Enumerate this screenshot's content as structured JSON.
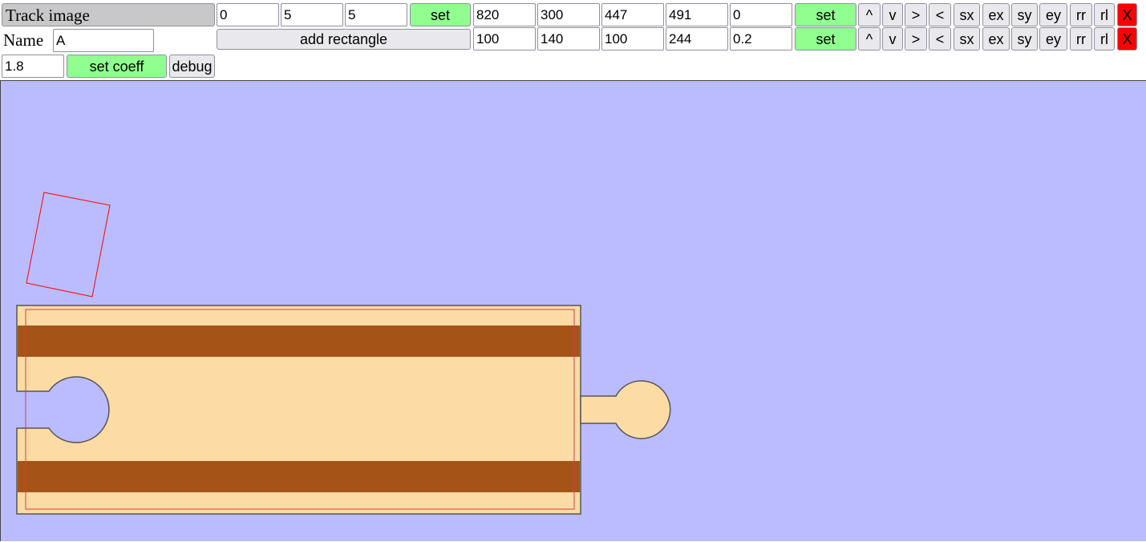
{
  "toolbar": {
    "track_image_label": "Track image",
    "name_label": "Name",
    "name_value": "A",
    "coords1": [
      "0",
      "5",
      "5"
    ],
    "set_label": "set",
    "add_rectangle_label": "add rectangle",
    "coeff_value": "1.8",
    "set_coeff_label": "set coeff",
    "debug_label": "debug"
  },
  "rects": [
    {
      "values": [
        "820",
        "300",
        "447",
        "491",
        "0"
      ]
    },
    {
      "values": [
        "100",
        "140",
        "100",
        "244",
        "0.2"
      ]
    }
  ],
  "row_buttons": [
    "^",
    "v",
    ">",
    "<",
    "sx",
    "ex",
    "sy",
    "ey",
    "rr",
    "rl"
  ],
  "delete_label": "X",
  "colors": {
    "canvas_bg": "#babcff",
    "track_body": "#fddba5",
    "rail": "#a65318",
    "outline_rect": "#ff0000",
    "green_button": "#90ff90",
    "red_button": "#ff0000"
  }
}
